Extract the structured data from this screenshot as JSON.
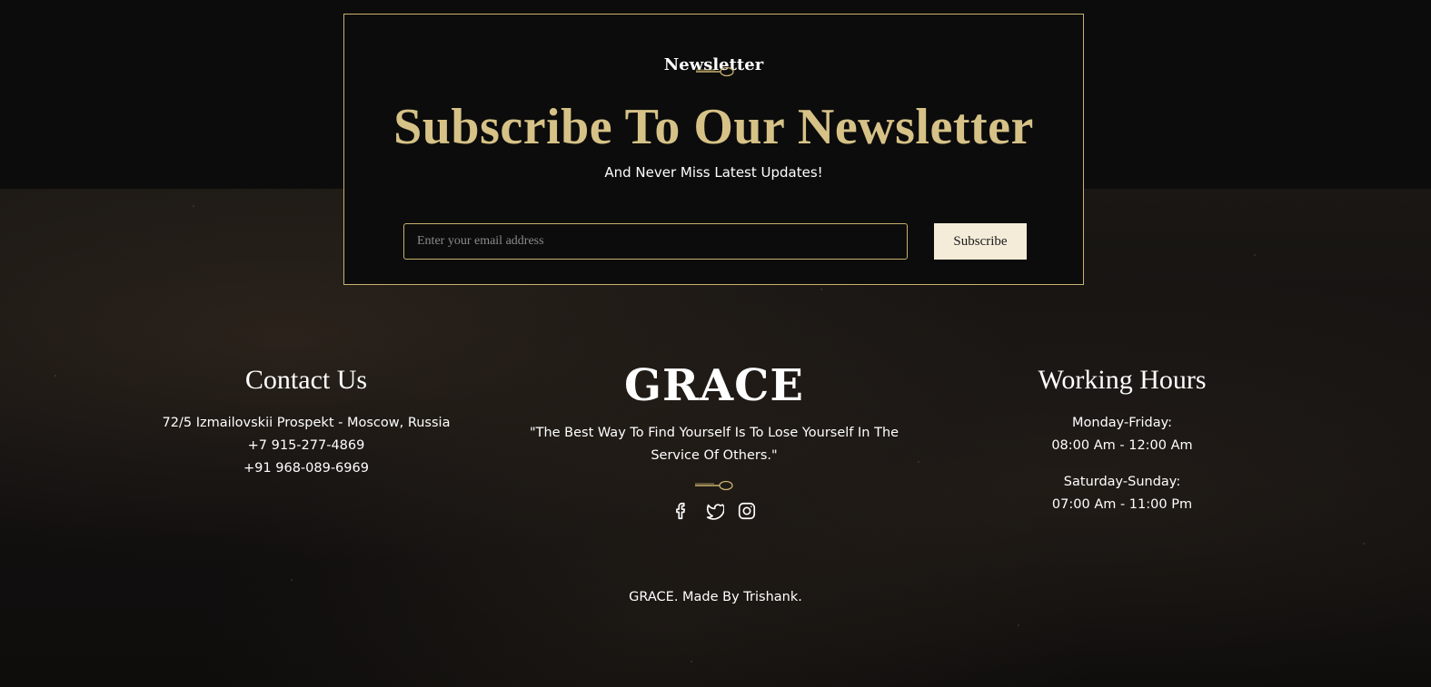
{
  "newsletter": {
    "eyebrow": "Newsletter",
    "title": "Subscribe To Our Newsletter",
    "subtitle": "And Never Miss Latest Updates!",
    "email_placeholder": "Enter your email address",
    "email_value": "",
    "subscribe_label": "Subscribe"
  },
  "contact": {
    "heading": "Contact Us",
    "address": "72/5 Izmailovskii Prospekt - Moscow, Russia",
    "phones": [
      "+7 915-277-4869",
      "+91 968-089-6969"
    ]
  },
  "brand": {
    "logo": "GRACE",
    "quote": "\"The Best Way To Find Yourself Is To Lose Yourself In The Service Of Others.\"",
    "social": [
      {
        "name": "facebook-icon"
      },
      {
        "name": "twitter-icon"
      },
      {
        "name": "instagram-icon"
      }
    ]
  },
  "hours": {
    "heading": "Working Hours",
    "groups": [
      {
        "days": "Monday-Friday:",
        "time": "08:00 Am - 12:00 Am"
      },
      {
        "days": "Saturday-Sunday:",
        "time": "07:00 Am - 11:00 Pm"
      }
    ]
  },
  "footer": {
    "copyright": "GRACE. Made By Trishank."
  },
  "colors": {
    "accent_gold": "#d6c287",
    "border_gold": "#c9b26f",
    "button_bg": "#f4ecd9",
    "background": "#0c0c0c"
  }
}
